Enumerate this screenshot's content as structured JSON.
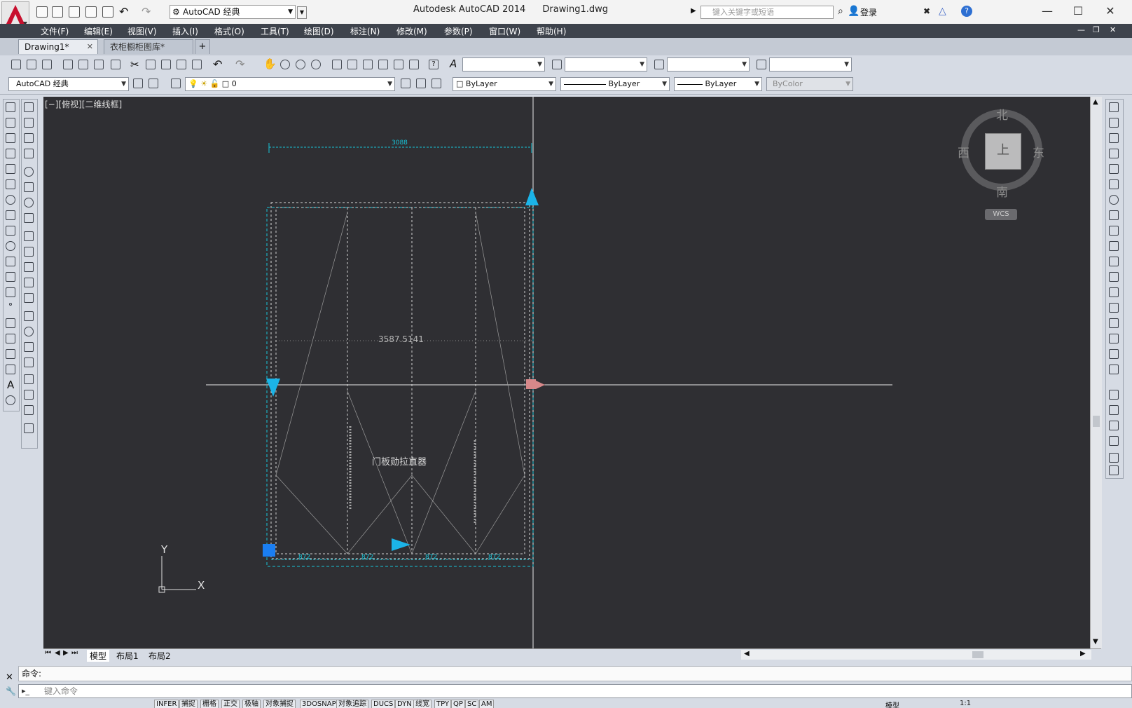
{
  "window": {
    "app_name": "Autodesk AutoCAD 2014",
    "file_name": "Drawing1.dwg",
    "minimize": "—",
    "maximize": "☐",
    "close": "✕"
  },
  "workspace": {
    "current": "AutoCAD 经典"
  },
  "search": {
    "placeholder": "键入关键字或短语"
  },
  "account": {
    "login_label": "登录"
  },
  "menu": [
    "文件(F)",
    "编辑(E)",
    "视图(V)",
    "插入(I)",
    "格式(O)",
    "工具(T)",
    "绘图(D)",
    "标注(N)",
    "修改(M)",
    "参数(P)",
    "窗口(W)",
    "帮助(H)"
  ],
  "file_tabs": [
    {
      "label": "Drawing1*",
      "active": true
    },
    {
      "label": "衣柜橱柜图库*",
      "active": false
    }
  ],
  "toolbar2": {
    "workspace_combo": "AutoCAD 经典",
    "layer_combo": "0",
    "color_combo": "ByLayer",
    "linetype_combo": "ByLayer",
    "lineweight_combo": "ByLayer",
    "plotstyle_combo": "ByColor"
  },
  "viewport": {
    "label": "[−][俯视][二维线框]",
    "background": "#2f2f33",
    "dimension_text": "3587.5141",
    "block_label": "门板勋拉直器",
    "top_dim_label": "3088",
    "bottom_dim_labels": [
      "872",
      "872",
      "872",
      "872"
    ]
  },
  "viewcube": {
    "north": "北",
    "south": "南",
    "east": "东",
    "west": "西",
    "face": "上",
    "ucs_label": "WCS"
  },
  "ucs_icon": {
    "x_label": "X",
    "y_label": "Y"
  },
  "layout_tabs": [
    "模型",
    "布局1",
    "布局2"
  ],
  "command": {
    "history_label": "命令:",
    "input_placeholder": "键入命令"
  },
  "status": {
    "items": [
      "INFER",
      "捕捉",
      "栅格",
      "正交",
      "极轴",
      "对象捕捉",
      "3DOSNAP",
      "对象追踪",
      "DUCS",
      "DYN",
      "线宽",
      "TPY",
      "QP",
      "SC",
      "AM"
    ],
    "model_label": "模型",
    "scale": "1:1"
  }
}
